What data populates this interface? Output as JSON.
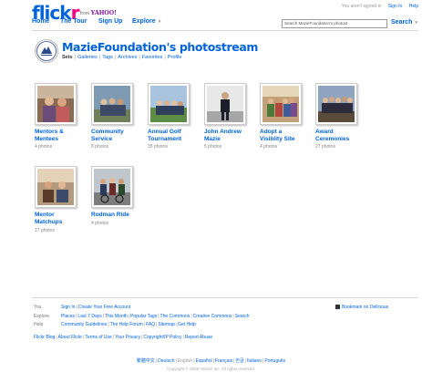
{
  "header": {
    "logo_blue": "flick",
    "logo_pink": "r",
    "from_label": "from",
    "yahoo_label": "YAHOO!",
    "signed_out_text": "You aren't signed in",
    "sign_in": "Sign In",
    "help": "Help"
  },
  "nav": {
    "items": [
      "Home",
      "The Tour",
      "Sign Up",
      "Explore"
    ],
    "search_placeholder": "Search MazieFoundation's photost",
    "search_button": "Search"
  },
  "profile": {
    "title": "MazieFoundation's photostream",
    "subnav": [
      "Sets",
      "Galleries",
      "Tags",
      "Archives",
      "Favorites",
      "Profile"
    ]
  },
  "sets": [
    {
      "title_lines": [
        "Mentors &",
        "Mentees"
      ],
      "count": "4 photos"
    },
    {
      "title_lines": [
        "Community",
        "Service"
      ],
      "count": "8 photos"
    },
    {
      "title_lines": [
        "Annual Golf",
        "Tournament"
      ],
      "count": "35 photos"
    },
    {
      "title_lines": [
        "John Andrew",
        "Mazie"
      ],
      "count": "5 photos"
    },
    {
      "title_lines": [
        "Adopt a",
        "Visiblity Site"
      ],
      "count": "4 photos"
    },
    {
      "title_lines": [
        "Award",
        "Ceremonies"
      ],
      "count": "27 photos"
    },
    {
      "title_lines": [
        "Mentor",
        "Matchups"
      ],
      "count": "17 photos"
    },
    {
      "title_lines": [
        "Rodman Ride"
      ],
      "count": "4 photos"
    }
  ],
  "footer": {
    "rows": [
      {
        "label": "You",
        "links": [
          "Sign In",
          "Create Your Free Account"
        ]
      },
      {
        "label": "Explore",
        "links": [
          "Places",
          "Last 7 Days",
          "This Month",
          "Popular Tags",
          "The Commons",
          "Creative Commons",
          "Search"
        ]
      },
      {
        "label": "Help",
        "links": [
          "Community Guidelines",
          "The Help Forum",
          "FAQ",
          "Sitemap",
          "Get Help"
        ]
      }
    ],
    "delicious": "Bookmark on Delicious",
    "bottom_links": [
      "Flickr Blog",
      "About Flickr",
      "Terms of Use",
      "Your Privacy",
      "Copyright/IP Policy",
      "Report Abuse"
    ],
    "languages": [
      "繁體中文",
      "Deutsch",
      "English",
      "Español",
      "Français",
      "한글",
      "Italiano",
      "Português"
    ],
    "current_language": "English",
    "copyright": "Copyright © 2009 Yahoo! Inc. All rights reserved."
  },
  "colors": {
    "link_blue": "#0063dc",
    "flickr_pink": "#ff0084"
  }
}
